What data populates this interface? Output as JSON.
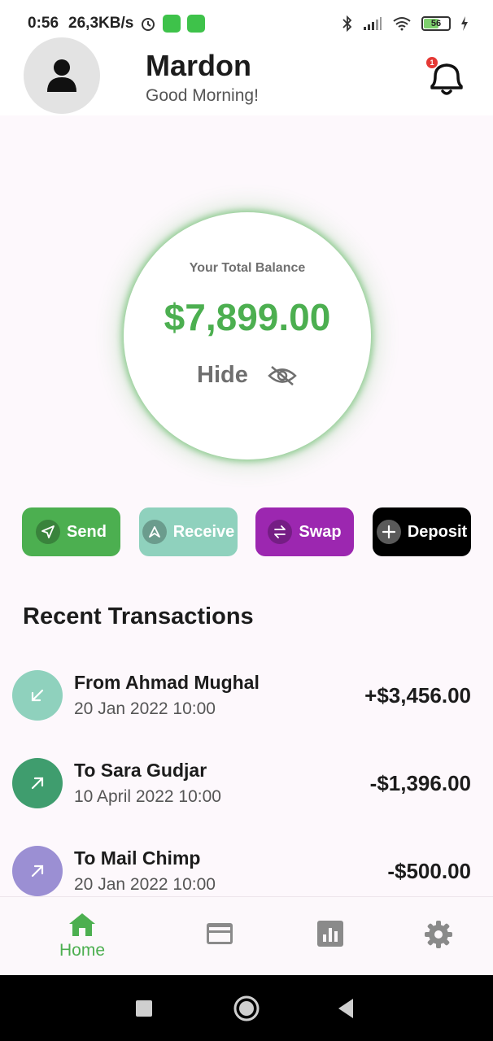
{
  "status_bar": {
    "time": "0:56",
    "speed": "26,3KB/s",
    "battery_level": "56"
  },
  "header": {
    "user_name": "Mardon",
    "greeting": "Good Morning!",
    "notification_count": "1"
  },
  "balance": {
    "label": "Your Total Balance",
    "amount": "$7,899.00",
    "hide_label": "Hide"
  },
  "actions": [
    {
      "label": "Send",
      "color": "#4caf50"
    },
    {
      "label": "Receive",
      "color": "#8fd1bd"
    },
    {
      "label": "Swap",
      "color": "#9c27b0"
    },
    {
      "label": "Deposit",
      "color": "#000000"
    }
  ],
  "transactions": {
    "title": "Recent Transactions",
    "items": [
      {
        "title": "From Ahmad Mughal",
        "date": "20 Jan 2022 10:00",
        "amount": "+$3,456.00",
        "icon_color": "#8fd1bd",
        "icon": "arrow-down-left-icon"
      },
      {
        "title": "To Sara Gudjar",
        "date": "10 April 2022 10:00",
        "amount": "-$1,396.00",
        "icon_color": "#3f9d6e",
        "icon": "arrow-up-right-icon"
      },
      {
        "title": "To Mail Chimp",
        "date": "20 Jan 2022 10:00",
        "amount": "-$500.00",
        "icon_color": "#9b8fd3",
        "icon": "arrow-up-right-icon"
      }
    ]
  },
  "bottom_nav": {
    "home_label": "Home",
    "active_color": "#4caf50",
    "inactive_color": "#8a8a8a"
  }
}
